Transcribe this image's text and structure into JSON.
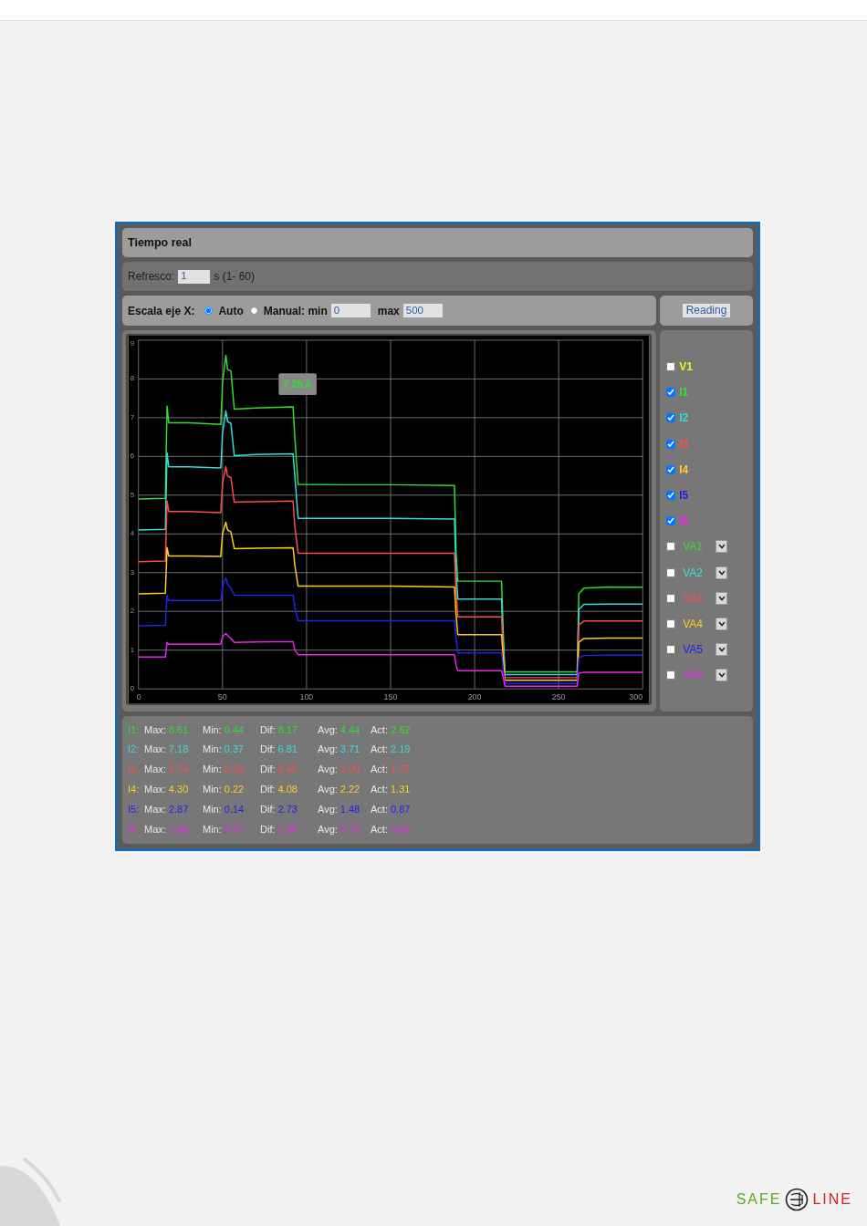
{
  "panel": {
    "title": "Tiempo real",
    "refresh": {
      "label": "Refresco:",
      "value": "1",
      "hint": "s (1- 60)"
    },
    "x_axis": {
      "label": "Escala eje X:",
      "modes": [
        {
          "label": "Auto",
          "selected": true
        },
        {
          "label": "Manual: min",
          "selected": false
        }
      ],
      "min": "0",
      "max_label": "max",
      "max": "500"
    },
    "reading_button": "Reading",
    "chart_data": {
      "type": "line",
      "x": [
        0,
        16,
        17,
        18,
        30,
        49,
        50,
        52,
        53,
        55,
        57,
        70,
        92,
        93,
        95,
        120,
        150,
        188,
        189,
        190,
        200,
        216,
        217,
        218,
        240,
        261,
        262,
        265,
        280,
        300
      ],
      "xlim": [
        0,
        300
      ],
      "ylim": [
        0,
        9
      ],
      "xticks": [
        0,
        50,
        100,
        150,
        200,
        250,
        300
      ],
      "yticks": [
        0,
        1,
        2,
        3,
        4,
        5,
        6,
        7,
        8,
        9
      ],
      "series": [
        {
          "color": "#33dd33",
          "values": [
            4.9,
            4.92,
            7.3,
            6.87,
            6.87,
            6.83,
            7.9,
            8.61,
            8.25,
            8.2,
            7.22,
            7.25,
            7.28,
            6.5,
            5.28,
            5.27,
            5.27,
            5.25,
            3.5,
            2.78,
            2.78,
            2.78,
            1.5,
            0.44,
            0.44,
            0.44,
            2.45,
            2.6,
            2.63,
            2.62
          ]
        },
        {
          "color": "#33dddd",
          "values": [
            4.1,
            4.12,
            6.1,
            5.73,
            5.73,
            5.7,
            6.6,
            7.18,
            6.9,
            6.85,
            6.02,
            6.05,
            6.07,
            5.5,
            4.4,
            4.4,
            4.4,
            4.38,
            3.0,
            2.32,
            2.32,
            2.32,
            1.2,
            0.37,
            0.37,
            0.37,
            2.05,
            2.18,
            2.19,
            2.19
          ]
        },
        {
          "color": "#ff4d4d",
          "values": [
            3.28,
            3.3,
            4.85,
            4.58,
            4.58,
            4.55,
            5.3,
            5.74,
            5.5,
            5.45,
            4.82,
            4.83,
            4.85,
            4.2,
            3.5,
            3.5,
            3.5,
            3.5,
            2.5,
            1.86,
            1.86,
            1.86,
            1.0,
            0.29,
            0.29,
            0.29,
            1.65,
            1.75,
            1.75,
            1.75
          ]
        },
        {
          "color": "#ffcc22",
          "values": [
            2.45,
            2.47,
            3.65,
            3.43,
            3.43,
            3.42,
            4.0,
            4.3,
            4.1,
            4.05,
            3.62,
            3.63,
            3.64,
            3.2,
            2.65,
            2.65,
            2.65,
            2.63,
            1.9,
            1.4,
            1.4,
            1.4,
            0.8,
            0.22,
            0.22,
            0.22,
            1.2,
            1.3,
            1.31,
            1.31
          ]
        },
        {
          "color": "#2222ee",
          "values": [
            1.63,
            1.64,
            2.4,
            2.28,
            2.28,
            2.28,
            2.65,
            2.87,
            2.7,
            2.6,
            2.42,
            2.42,
            2.42,
            2.1,
            1.76,
            1.76,
            1.76,
            1.76,
            1.3,
            0.93,
            0.93,
            0.93,
            0.5,
            0.14,
            0.14,
            0.14,
            0.8,
            0.86,
            0.87,
            0.87
          ]
        },
        {
          "color": "#ee22ee",
          "values": [
            0.82,
            0.82,
            1.2,
            1.15,
            1.15,
            1.15,
            1.35,
            1.43,
            1.38,
            1.3,
            1.2,
            1.21,
            1.22,
            1.0,
            0.88,
            0.88,
            0.88,
            0.88,
            0.6,
            0.47,
            0.47,
            0.47,
            0.3,
            0.07,
            0.07,
            0.07,
            0.4,
            0.43,
            0.43,
            0.43
          ]
        }
      ],
      "grid": true,
      "annotations": [
        {
          "x": 92,
          "y": 7.28,
          "text": "7.28 A"
        }
      ]
    },
    "channels": [
      {
        "label": "V1",
        "color": "#eeee22",
        "checked": false,
        "kind": "plain"
      },
      {
        "label": "I1",
        "color": "#33dd33",
        "checked": true,
        "kind": "plain"
      },
      {
        "label": "I2",
        "color": "#33dddd",
        "checked": true,
        "kind": "plain"
      },
      {
        "label": "I3",
        "color": "#ff4d4d",
        "checked": true,
        "kind": "plain"
      },
      {
        "label": "I4",
        "color": "#ffcc22",
        "checked": true,
        "kind": "plain"
      },
      {
        "label": "I5",
        "color": "#2222ee",
        "checked": true,
        "kind": "plain"
      },
      {
        "label": "I6",
        "color": "#ee22ee",
        "checked": true,
        "kind": "plain"
      },
      {
        "label": "VA1",
        "color": "#33dd33",
        "checked": false,
        "kind": "select"
      },
      {
        "label": "VA2",
        "color": "#33dddd",
        "checked": false,
        "kind": "select"
      },
      {
        "label": "VA3",
        "color": "#ff4d4d",
        "checked": false,
        "kind": "select"
      },
      {
        "label": "VA4",
        "color": "#ffcc22",
        "checked": false,
        "kind": "select"
      },
      {
        "label": "VA5",
        "color": "#2222ee",
        "checked": false,
        "kind": "select"
      },
      {
        "label": "VA6",
        "color": "#ee22ee",
        "checked": false,
        "kind": "select"
      }
    ],
    "stats": [
      {
        "label": "I1:",
        "color": "#33dd33",
        "items": [
          {
            "name": "Max:",
            "value": "8.61"
          },
          {
            "name": "Min:",
            "value": "0.44"
          },
          {
            "name": "Dif:",
            "value": "8.17"
          },
          {
            "name": "Avg:",
            "value": "4.44"
          },
          {
            "name": "Act:",
            "value": "2.62"
          }
        ]
      },
      {
        "label": "I2:",
        "color": "#33dddd",
        "items": [
          {
            "name": "Max:",
            "value": "7.18"
          },
          {
            "name": "Min:",
            "value": "0.37"
          },
          {
            "name": "Dif:",
            "value": "6.81"
          },
          {
            "name": "Avg:",
            "value": "3.71"
          },
          {
            "name": "Act:",
            "value": "2.19"
          }
        ]
      },
      {
        "label": "I3:",
        "color": "#ff4d4d",
        "items": [
          {
            "name": "Max:",
            "value": "5.74"
          },
          {
            "name": "Min:",
            "value": "0.29"
          },
          {
            "name": "Dif:",
            "value": "5.45"
          },
          {
            "name": "Avg:",
            "value": "2.90"
          },
          {
            "name": "Act:",
            "value": "1.75"
          }
        ]
      },
      {
        "label": "I4:",
        "color": "#ffcc22",
        "items": [
          {
            "name": "Max:",
            "value": "4.30"
          },
          {
            "name": "Min:",
            "value": "0.22"
          },
          {
            "name": "Dif:",
            "value": "4.08"
          },
          {
            "name": "Avg:",
            "value": "2.22"
          },
          {
            "name": "Act:",
            "value": "1.31"
          }
        ]
      },
      {
        "label": "I5:",
        "color": "#2222ee",
        "items": [
          {
            "name": "Max:",
            "value": "2.87"
          },
          {
            "name": "Min:",
            "value": "0.14"
          },
          {
            "name": "Dif:",
            "value": "2.73"
          },
          {
            "name": "Avg:",
            "value": "1.48"
          },
          {
            "name": "Act:",
            "value": "0.87"
          }
        ]
      },
      {
        "label": "I6:",
        "color": "#ee22ee",
        "items": [
          {
            "name": "Max:",
            "value": "1.43"
          },
          {
            "name": "Min:",
            "value": "0.07"
          },
          {
            "name": "Dif:",
            "value": "1.36"
          },
          {
            "name": "Avg:",
            "value": "0.73"
          },
          {
            "name": "Act:",
            "value": "0.43"
          }
        ]
      }
    ]
  },
  "logo": {
    "left": "SAFE",
    "right": "LINE"
  }
}
